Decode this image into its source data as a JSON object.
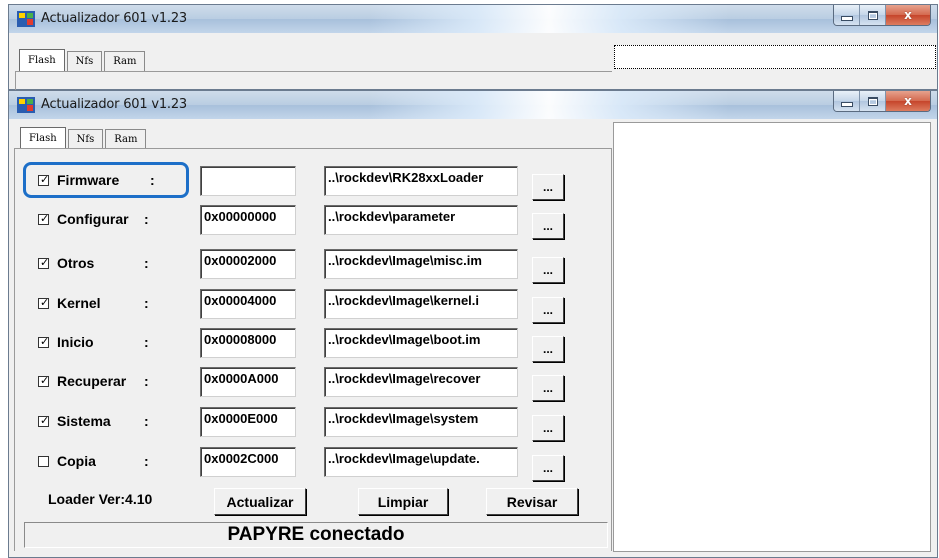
{
  "background_window": {
    "title": "Actualizador 601 v1.23",
    "tabs": [
      "Flash",
      "Nfs",
      "Ram"
    ]
  },
  "main_window": {
    "title": "Actualizador 601 v1.23",
    "tabs": [
      "Flash",
      "Nfs",
      "Ram"
    ],
    "active_tab": "Flash",
    "rows": [
      {
        "checked": true,
        "label": "Firmware",
        "colon": ":",
        "address": "",
        "path": "..\\rockdev\\RK28xxLoader",
        "browse": "..."
      },
      {
        "checked": true,
        "label": "Configurar",
        "colon": ":",
        "address": "0x00000000",
        "path": "..\\rockdev\\parameter",
        "browse": "..."
      },
      {
        "checked": true,
        "label": "Otros",
        "colon": ":",
        "address": "0x00002000",
        "path": "..\\rockdev\\Image\\misc.im",
        "browse": "..."
      },
      {
        "checked": true,
        "label": "Kernel",
        "colon": ":",
        "address": "0x00004000",
        "path": "..\\rockdev\\Image\\kernel.i",
        "browse": "..."
      },
      {
        "checked": true,
        "label": "Inicio",
        "colon": ":",
        "address": "0x00008000",
        "path": "..\\rockdev\\Image\\boot.im",
        "browse": "..."
      },
      {
        "checked": true,
        "label": "Recuperar",
        "colon": ":",
        "address": "0x0000A000",
        "path": "..\\rockdev\\Image\\recover",
        "browse": "..."
      },
      {
        "checked": true,
        "label": "Sistema",
        "colon": ":",
        "address": "0x0000E000",
        "path": "..\\rockdev\\Image\\system",
        "browse": "..."
      },
      {
        "checked": false,
        "label": "Copia",
        "colon": ":",
        "address": "0x0002C000",
        "path": "..\\rockdev\\Image\\update.",
        "browse": "..."
      }
    ],
    "loader_version": "Loader Ver:4.10",
    "buttons": {
      "update": "Actualizar",
      "clear": "Limpiar",
      "check": "Revisar"
    },
    "status_text": "PAPYRE conectado",
    "check_mark": "✓",
    "close_glyph": "x",
    "highlight_color": "#1d6fc8"
  }
}
